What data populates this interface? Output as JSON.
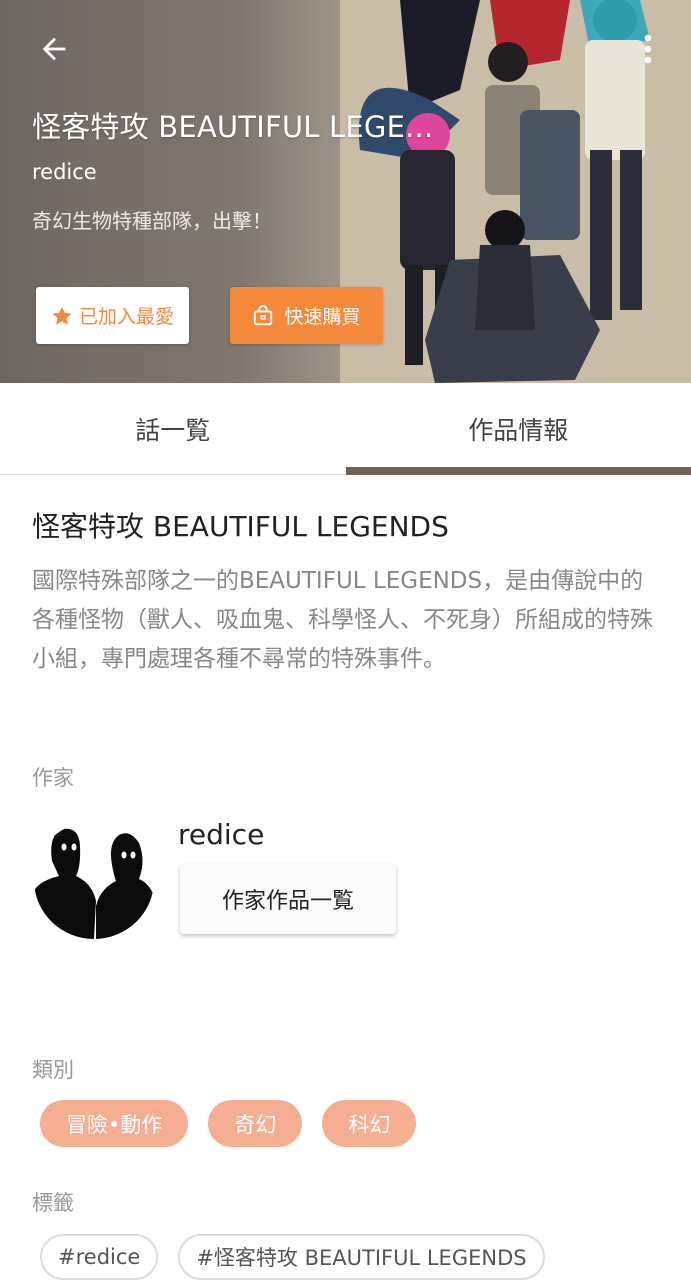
{
  "header": {
    "title": "怪客特攻 BEAUTIFUL LEGE...",
    "author": "redice",
    "tagline": "奇幻生物特種部隊，出擊！",
    "favorite_label": "已加入最愛",
    "buy_label": "快速購買",
    "icons": {
      "back": "arrow-left-icon",
      "more": "more-vertical-icon",
      "favorite": "star-icon",
      "buy": "shopping-bag-icon"
    },
    "colors": {
      "accent": "#f4893c"
    }
  },
  "tabs": [
    {
      "label": "話一覧",
      "active": false
    },
    {
      "label": "作品情報",
      "active": true
    }
  ],
  "work": {
    "title": "怪客特攻 BEAUTIFUL LEGENDS",
    "description": "國際特殊部隊之一的BEAUTIFUL LEGENDS，是由傳說中的各種怪物（獸人、吸血鬼、科學怪人、不死身）所組成的特殊小組，專門處理各種不尋常的特殊事件。"
  },
  "author_section": {
    "label": "作家",
    "name": "redice",
    "works_button": "作家作品一覧"
  },
  "category_section": {
    "label": "類別",
    "items": [
      "冒險•動作",
      "奇幻",
      "科幻"
    ],
    "chip_color": "#f6ae93"
  },
  "tag_section": {
    "label": "標籤",
    "items": [
      "#redice",
      "#怪客特攻 BEAUTIFUL LEGENDS"
    ]
  }
}
